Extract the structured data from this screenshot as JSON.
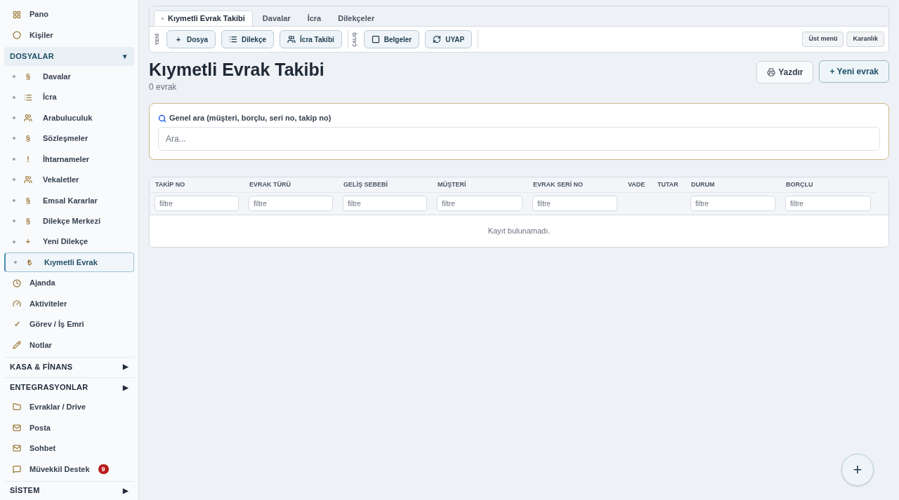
{
  "sidebar": {
    "items": [
      {
        "kind": "item",
        "label": "Pano",
        "selected": false
      },
      {
        "kind": "item",
        "label": "Kişiler",
        "selected": false
      },
      {
        "kind": "section",
        "label": "DOSYALAR",
        "caret": "▼",
        "selected": true
      },
      {
        "kind": "subitem",
        "glyph": "§",
        "label": "Davalar",
        "selected": false
      },
      {
        "kind": "subitem",
        "label": "İcra",
        "selected": false
      },
      {
        "kind": "subitem",
        "label": "Arabuluculuk",
        "selected": false
      },
      {
        "kind": "subitem",
        "glyph": "§",
        "label": "Sözleşmeler",
        "selected": false
      },
      {
        "kind": "subitem",
        "glyph": "!",
        "label": "İhtarnameler",
        "selected": false
      },
      {
        "kind": "subitem",
        "label": "Vekaletler",
        "selected": false
      },
      {
        "kind": "subitem",
        "glyph": "§",
        "label": "Emsal Kararlar",
        "selected": false
      },
      {
        "kind": "subitem",
        "glyph": "§",
        "label": "Dilekçe Merkezi",
        "selected": false
      },
      {
        "kind": "subitem",
        "glyph": "+",
        "label": "Yeni Dilekçe",
        "selected": false
      },
      {
        "kind": "subitem",
        "glyph": "₺",
        "label": "Kıymetli Evrak",
        "selected": true
      },
      {
        "kind": "item",
        "label": "Ajanda",
        "selected": false
      },
      {
        "kind": "item",
        "label": "Aktiviteler",
        "selected": false
      },
      {
        "kind": "item",
        "glyph": "✓",
        "label": "Görev / İş Emri",
        "selected": false
      },
      {
        "kind": "item",
        "label": "Notlar",
        "selected": false
      },
      {
        "kind": "section",
        "label": "KASA & FİNANS",
        "caret": "▶",
        "selected": false
      },
      {
        "kind": "section",
        "label": "ENTEGRASYONLAR",
        "caret": "▶",
        "selected": false
      },
      {
        "kind": "item",
        "label": "Evraklar / Drive",
        "selected": false
      },
      {
        "kind": "item",
        "label": "Posta",
        "selected": false
      },
      {
        "kind": "item",
        "label": "Sohbet",
        "selected": false
      },
      {
        "kind": "item",
        "label": "Müvekkil Destek",
        "badge": "9",
        "selected": false
      },
      {
        "kind": "section",
        "label": "SİSTEM",
        "caret": "▶",
        "selected": false
      }
    ]
  },
  "tabs": [
    {
      "label": "Kıymetli Evrak Takibi",
      "selected": true
    },
    {
      "label": "Davalar",
      "selected": false
    },
    {
      "label": "İcra",
      "selected": false
    },
    {
      "label": "Dilekçeler",
      "selected": false
    }
  ],
  "toolbar": {
    "groups": [
      {
        "label": "YENİ",
        "buttons": [
          {
            "glyph": "+",
            "label": "Dosya"
          },
          {
            "label": "Dilekçe"
          },
          {
            "label": "İcra Takibi"
          }
        ]
      },
      {
        "label": "ÇALIŞ",
        "buttons": [
          {
            "label": "Belgeler"
          },
          {
            "label": "UYAP"
          }
        ]
      }
    ],
    "right_buttons": [
      "Üst menü",
      "Karanlık"
    ]
  },
  "page": {
    "title": "Kıymetli Evrak Takibi",
    "subtitle": "0 evrak",
    "print_button": "Yazdır",
    "new_button": "+ Yeni evrak"
  },
  "search": {
    "label": "Genel ara (müşteri, borçlu, seri no, takip no)",
    "placeholder": "Ara..."
  },
  "table": {
    "columns": [
      {
        "label": "TAKİP NO",
        "placeholder": "filtre"
      },
      {
        "label": "EVRAK TÜRÜ",
        "placeholder": "filtre"
      },
      {
        "label": "GELİŞ SEBEBİ",
        "placeholder": "filtre"
      },
      {
        "label": "MÜŞTERİ",
        "placeholder": "filtre"
      },
      {
        "label": "EVRAK SERİ NO",
        "placeholder": "filtre"
      },
      {
        "label": "VADE"
      },
      {
        "label": "TUTAR"
      },
      {
        "label": "DURUM",
        "placeholder": "filtre"
      },
      {
        "label": "BORÇLU",
        "placeholder": "filtre"
      }
    ],
    "empty_message": "Kayıt bulunamadı."
  },
  "fab": {
    "glyph": "+"
  }
}
